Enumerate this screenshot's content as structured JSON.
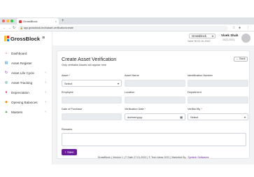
{
  "browser": {
    "tab_title": "GrossBlock",
    "tab_close": "×",
    "new_tab": "+",
    "url": "app.grossblock.tech/asset-verification/create",
    "traffic_colors": [
      "#ff5f57",
      "#febc2e",
      "#28c840"
    ]
  },
  "sidebar": {
    "logo_text": "GrossBlock",
    "items": [
      {
        "label": "Dashboard",
        "icon": "dashboard-icon",
        "glyph": "⌂",
        "color": "#e53935",
        "chevron": ""
      },
      {
        "label": "Asset Register",
        "icon": "register-icon",
        "glyph": "▤",
        "color": "#1e88e5",
        "chevron": ""
      },
      {
        "label": "Asset Life Cycle",
        "icon": "lifecycle-icon",
        "glyph": "↻",
        "color": "#8e24aa",
        "chevron": "‹"
      },
      {
        "label": "Asset Tracking",
        "icon": "tracking-icon",
        "glyph": "◎",
        "color": "#00897b",
        "chevron": "‹"
      },
      {
        "label": "Depreciation",
        "icon": "depreciation-icon",
        "glyph": "●",
        "color": "#e91e63",
        "chevron": "‹"
      },
      {
        "label": "Opening Balances",
        "icon": "balances-icon",
        "glyph": "◆",
        "color": "#fb8c00",
        "chevron": "‹"
      },
      {
        "label": "Masters",
        "icon": "masters-icon",
        "glyph": "▲",
        "color": "#43a047",
        "chevron": "‹"
      }
    ]
  },
  "header": {
    "company": "Grossblock",
    "validity": "Valid Till 03-10-2022",
    "user_name": "Vivek Shah",
    "user_date": "2022-2023"
  },
  "form": {
    "title": "Create Asset Verification",
    "subtitle": "Only verifiable Assets will appear here",
    "back_label": "Back",
    "fields": {
      "asset": {
        "label": "Asset",
        "required": "*",
        "value": "Select"
      },
      "asset_name": {
        "label": "Asset Name",
        "value": ""
      },
      "identification_number": {
        "label": "Identification Number",
        "value": ""
      },
      "employee": {
        "label": "Employee",
        "value": ""
      },
      "location": {
        "label": "Location",
        "value": ""
      },
      "department": {
        "label": "Department",
        "value": ""
      },
      "date_of_purchase": {
        "label": "Date of Purchase",
        "value": ""
      },
      "verification_date": {
        "label": "Verification Date",
        "required": "*",
        "value": "dd/mm/yyyy"
      },
      "verified_by": {
        "label": "Verified By",
        "required": "*",
        "value": "Select"
      },
      "remarks": {
        "label": "Remarks",
        "value": ""
      }
    },
    "save_label": "+ Save"
  },
  "footer": {
    "text": "GrossBlock | Version 1 | © Date 27-01-2022 | © Tech Ideas 2022 | Marketed By : ",
    "brand": "Syntech Softwares"
  },
  "colors": {
    "accent": "#6a1b9a",
    "required": "#d32f2f"
  }
}
